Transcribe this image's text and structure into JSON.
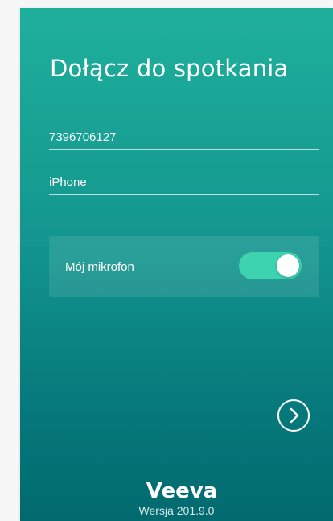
{
  "screen": {
    "title": "Dołącz do spotkania"
  },
  "form": {
    "meeting_id_value": "7396706127",
    "name_value": "iPhone"
  },
  "microphone": {
    "label": "Mój mikrofon",
    "enabled": true
  },
  "next_button": {
    "icon": "chevron-right-icon"
  },
  "footer": {
    "logo_text": "Veeva",
    "version": "Wersja 201.9.0"
  },
  "colors": {
    "gradient_top": "#1fb09c",
    "gradient_bottom": "#016a6f",
    "toggle_on": "#3ed3b0",
    "text": "#ffffff"
  }
}
